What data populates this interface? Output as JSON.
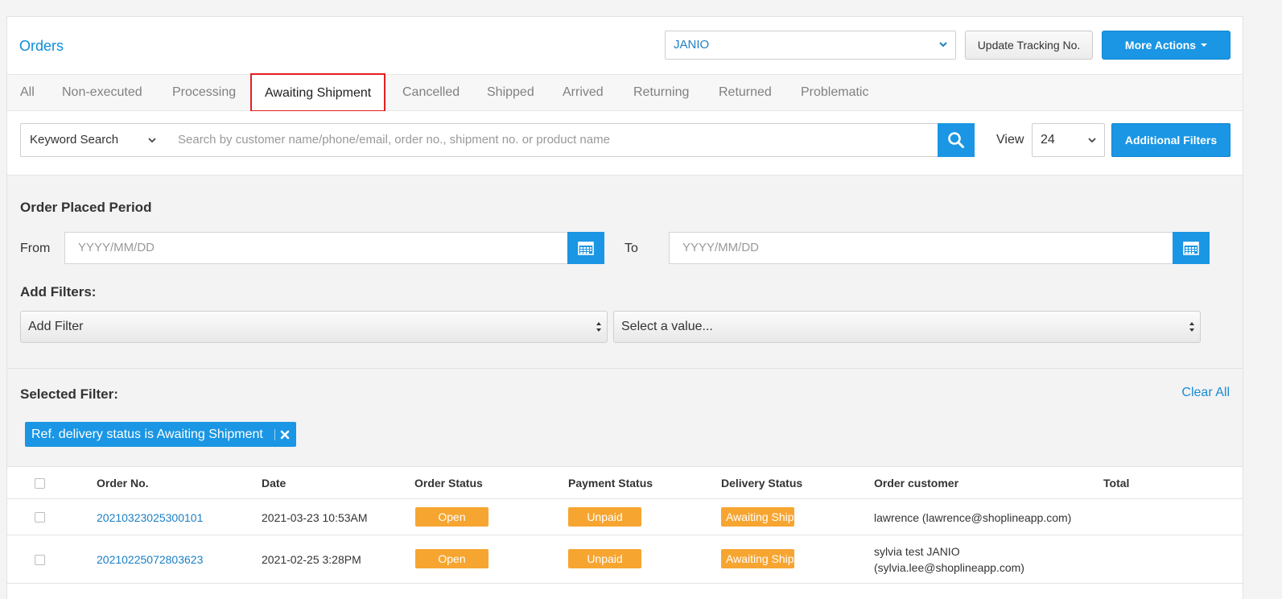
{
  "header": {
    "title": "Orders",
    "carrier": "JANIO",
    "update_tracking_label": "Update Tracking No.",
    "more_actions_label": "More Actions"
  },
  "tabs": [
    {
      "label": "All"
    },
    {
      "label": "Non-executed"
    },
    {
      "label": "Processing"
    },
    {
      "label": "Awaiting Shipment",
      "active": true
    },
    {
      "label": "Cancelled"
    },
    {
      "label": "Shipped"
    },
    {
      "label": "Arrived"
    },
    {
      "label": "Returning"
    },
    {
      "label": "Returned"
    },
    {
      "label": "Problematic"
    }
  ],
  "search": {
    "type": "Keyword Search",
    "placeholder": "Search by customer name/phone/email, order no., shipment no. or product name",
    "view_label": "View",
    "view_value": "24",
    "additional_filters_label": "Additional Filters"
  },
  "period": {
    "heading": "Order Placed Period",
    "from_label": "From",
    "to_label": "To",
    "from_placeholder": "YYYY/MM/DD",
    "to_placeholder": "YYYY/MM/DD"
  },
  "filters": {
    "heading": "Add Filters:",
    "add_filter": "Add Filter",
    "select_value": "Select a value..."
  },
  "selected": {
    "heading": "Selected Filter:",
    "clear_all": "Clear All",
    "chip": "Ref. delivery status is Awaiting Shipment"
  },
  "table": {
    "columns": [
      "Order No.",
      "Date",
      "Order Status",
      "Payment Status",
      "Delivery Status",
      "Order customer",
      "Total"
    ],
    "rows": [
      {
        "order_no": "20210323025300101",
        "date": "2021-03-23 10:53AM",
        "order_status": "Open",
        "payment_status": "Unpaid",
        "delivery_status": "Awaiting Shipment",
        "customer_line1": "lawrence (lawrence@shoplineapp.com)",
        "customer_line2": "",
        "total": ""
      },
      {
        "order_no": "20210225072803623",
        "date": "2021-02-25 3:28PM",
        "order_status": "Open",
        "payment_status": "Unpaid",
        "delivery_status": "Awaiting Shipment",
        "customer_line1": "sylvia test JANIO",
        "customer_line2": "(sylvia.lee@shoplineapp.com)",
        "total": ""
      }
    ]
  },
  "colors": {
    "primary": "#1a96e4",
    "link": "#1a7fc6",
    "status_orange": "#f7a531",
    "active_tab_border": "#e32020"
  }
}
